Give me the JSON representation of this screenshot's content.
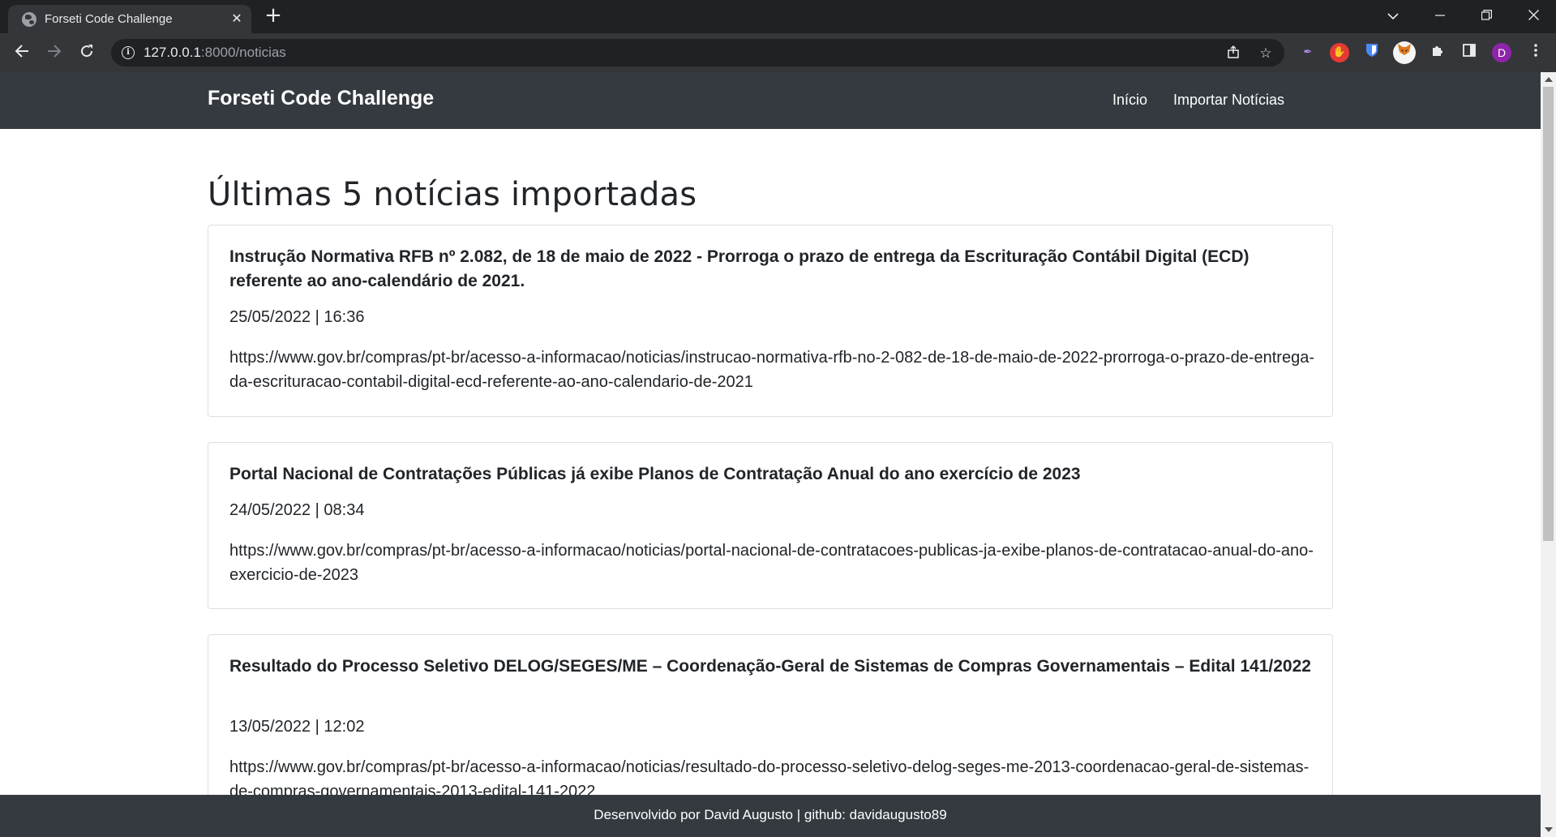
{
  "browser": {
    "tab_title": "Forseti Code Challenge",
    "tab_close": "✕",
    "new_tab": "+",
    "url_host": "127.0.0.1",
    "url_path": ":8000/noticias",
    "profile_initial": "D"
  },
  "site": {
    "brand": "Forseti Code Challenge",
    "nav": {
      "home": "Início",
      "import": "Importar Notícias"
    },
    "heading": "Últimas 5 notícias importadas",
    "news": [
      {
        "title": "Instrução Normativa RFB nº 2.082, de 18 de maio de 2022 - Prorroga o prazo de entrega da Escrituração Contábil Digital (ECD) referente ao ano-calendário de 2021.",
        "date": "25/05/2022 | 16:36",
        "link": "https://www.gov.br/compras/pt-br/acesso-a-informacao/noticias/instrucao-normativa-rfb-no-2-082-de-18-de-maio-de-2022-prorroga-o-prazo-de-entrega-da-escrituracao-contabil-digital-ecd-referente-ao-ano-calendario-de-2021"
      },
      {
        "title": "Portal Nacional de Contratações Públicas já exibe Planos de Contratação Anual do ano exercício de 2023",
        "date": "24/05/2022 | 08:34",
        "link": "https://www.gov.br/compras/pt-br/acesso-a-informacao/noticias/portal-nacional-de-contratacoes-publicas-ja-exibe-planos-de-contratacao-anual-do-ano-exercicio-de-2023"
      },
      {
        "title": "Resultado do Processo Seletivo DELOG/SEGES/ME – Coordenação-Geral de Sistemas de Compras Governamentais – Edital 141/2022",
        "date": "13/05/2022 | 12:02",
        "link": "https://www.gov.br/compras/pt-br/acesso-a-informacao/noticias/resultado-do-processo-seletivo-delog-seges-me-2013-coordenacao-geral-de-sistemas-de-compras-governamentais-2013-edital-141-2022"
      }
    ],
    "footer": "Desenvolvido por David Augusto | github: davidaugusto89"
  },
  "colors": {
    "navbar": "#343a40",
    "chrome_dark": "#202124",
    "chrome_toolbar": "#35363a"
  }
}
